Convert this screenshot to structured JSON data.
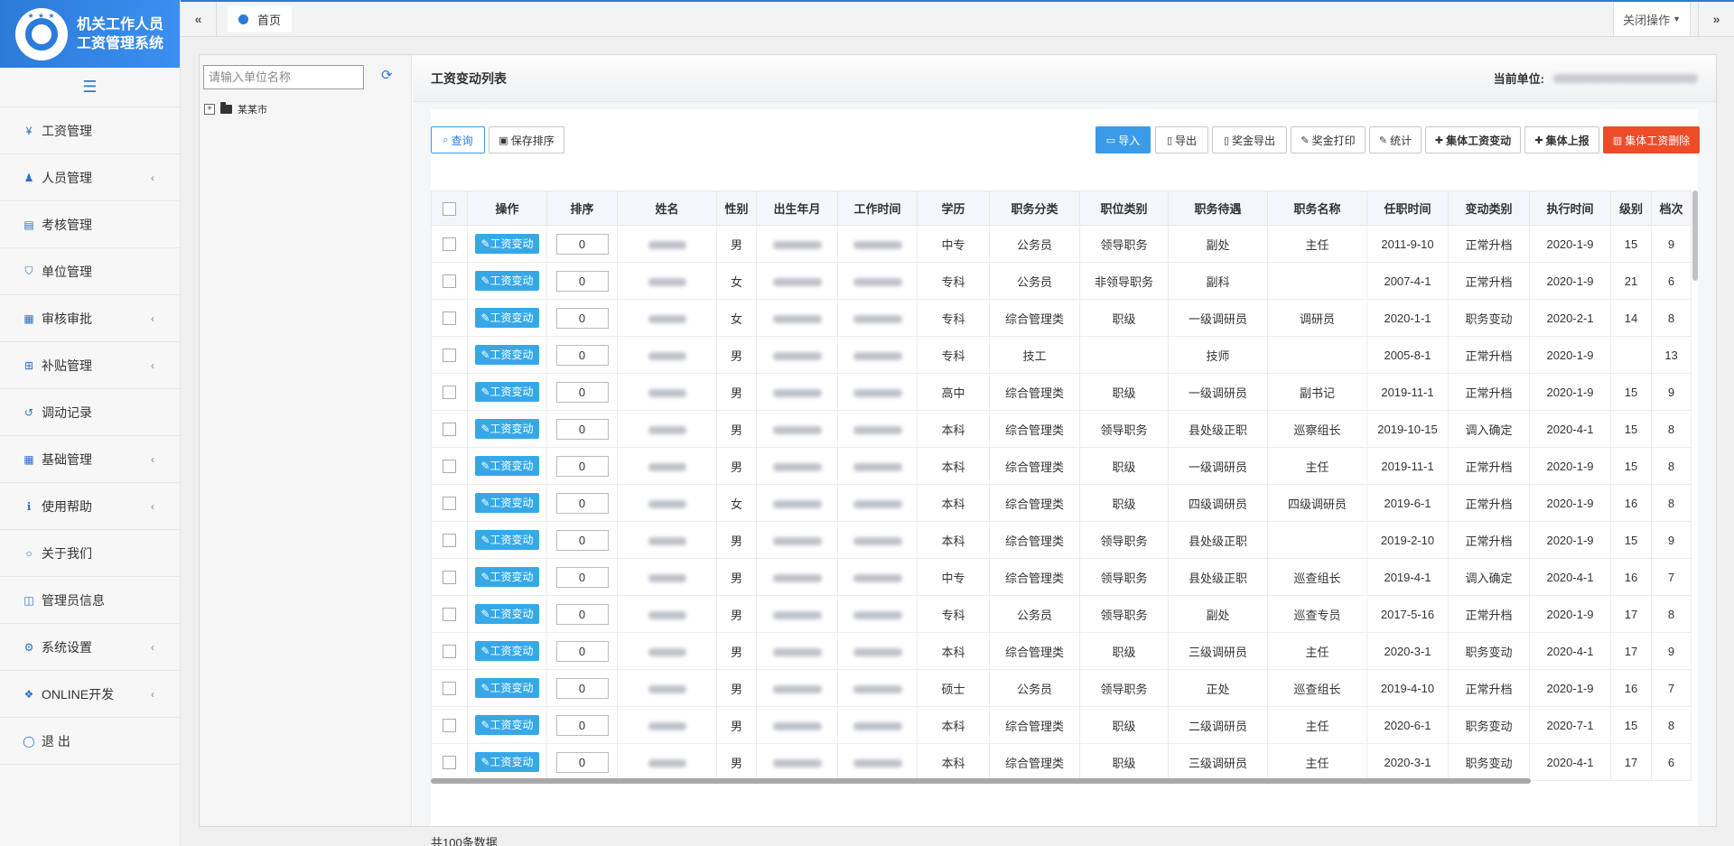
{
  "app": {
    "title_line1": "机关工作人员",
    "title_line2": "工资管理系统",
    "brand_color": "#2b7bd8"
  },
  "sidebar": {
    "items": [
      {
        "label": "工资管理",
        "icon": "yen-icon",
        "expandable": false
      },
      {
        "label": "人员管理",
        "icon": "user-add-icon",
        "expandable": true
      },
      {
        "label": "考核管理",
        "icon": "book-icon",
        "expandable": false
      },
      {
        "label": "单位管理",
        "icon": "shield-icon",
        "expandable": false
      },
      {
        "label": "审核审批",
        "icon": "calendar-check-icon",
        "expandable": true
      },
      {
        "label": "补贴管理",
        "icon": "plus-square-icon",
        "expandable": true
      },
      {
        "label": "调动记录",
        "icon": "history-icon",
        "expandable": false
      },
      {
        "label": "基础管理",
        "icon": "table-icon",
        "expandable": true
      },
      {
        "label": "使用帮助",
        "icon": "info-icon",
        "expandable": true
      },
      {
        "label": "关于我们",
        "icon": "circle-icon",
        "expandable": false
      },
      {
        "label": "管理员信息",
        "icon": "columns-icon",
        "expandable": false
      },
      {
        "label": "系统设置",
        "icon": "gear-icon",
        "expandable": true
      },
      {
        "label": "ONLINE开发",
        "icon": "cubes-icon",
        "expandable": true
      },
      {
        "label": "退  出",
        "icon": "power-icon",
        "expandable": false
      }
    ]
  },
  "topbar": {
    "home_tab": "首页",
    "close_ops": "关闭操作"
  },
  "tree": {
    "search_placeholder": "请输入单位名称",
    "root_node": "某某市"
  },
  "panel": {
    "title": "工资变动列表",
    "current_unit_label": "当前单位:"
  },
  "toolbar": {
    "query": "查询",
    "save_sort": "保存排序",
    "import": "导入",
    "export": "导出",
    "bonus_export": "奖金导出",
    "bonus_print": "奖金打印",
    "stats": "统计",
    "group_change": "集体工资变动",
    "group_report": "集体上报",
    "group_delete": "集体工资删除"
  },
  "table": {
    "headers": [
      "",
      "操作",
      "排序",
      "姓名",
      "性别",
      "出生年月",
      "工作时间",
      "学历",
      "职务分类",
      "职位类别",
      "职务待遇",
      "职务名称",
      "任职时间",
      "变动类别",
      "执行时间",
      "级别",
      "档次"
    ],
    "action_label": "工资变动",
    "rows": [
      {
        "sort": "0",
        "gender": "男",
        "edu": "中专",
        "cat": "公务员",
        "pos_type": "领导职务",
        "treat": "副处",
        "title": "主任",
        "start": "2011-9-10",
        "change": "正常升档",
        "exec": "2020-1-9",
        "level": "15",
        "grade": "9"
      },
      {
        "sort": "0",
        "gender": "女",
        "edu": "专科",
        "cat": "公务员",
        "pos_type": "非领导职务",
        "treat": "副科",
        "title": "",
        "start": "2007-4-1",
        "change": "正常升档",
        "exec": "2020-1-9",
        "level": "21",
        "grade": "6"
      },
      {
        "sort": "0",
        "gender": "女",
        "edu": "专科",
        "cat": "综合管理类",
        "pos_type": "职级",
        "treat": "一级调研员",
        "title": "调研员",
        "start": "2020-1-1",
        "change": "职务变动",
        "exec": "2020-2-1",
        "level": "14",
        "grade": "8"
      },
      {
        "sort": "0",
        "gender": "男",
        "edu": "专科",
        "cat": "技工",
        "pos_type": "",
        "treat": "技师",
        "title": "",
        "start": "2005-8-1",
        "change": "正常升档",
        "exec": "2020-1-9",
        "level": "",
        "grade": "13"
      },
      {
        "sort": "0",
        "gender": "男",
        "edu": "高中",
        "cat": "综合管理类",
        "pos_type": "职级",
        "treat": "一级调研员",
        "title": "副书记",
        "start": "2019-11-1",
        "change": "正常升档",
        "exec": "2020-1-9",
        "level": "15",
        "grade": "9"
      },
      {
        "sort": "0",
        "gender": "男",
        "edu": "本科",
        "cat": "综合管理类",
        "pos_type": "领导职务",
        "treat": "县处级正职",
        "title": "巡察组长",
        "start": "2019-10-15",
        "change": "调入确定",
        "exec": "2020-4-1",
        "level": "15",
        "grade": "8"
      },
      {
        "sort": "0",
        "gender": "男",
        "edu": "本科",
        "cat": "综合管理类",
        "pos_type": "职级",
        "treat": "一级调研员",
        "title": "主任",
        "start": "2019-11-1",
        "change": "正常升档",
        "exec": "2020-1-9",
        "level": "15",
        "grade": "8"
      },
      {
        "sort": "0",
        "gender": "女",
        "edu": "本科",
        "cat": "综合管理类",
        "pos_type": "职级",
        "treat": "四级调研员",
        "title": "四级调研员",
        "start": "2019-6-1",
        "change": "正常升档",
        "exec": "2020-1-9",
        "level": "16",
        "grade": "8"
      },
      {
        "sort": "0",
        "gender": "男",
        "edu": "本科",
        "cat": "综合管理类",
        "pos_type": "领导职务",
        "treat": "县处级正职",
        "title": "",
        "start": "2019-2-10",
        "change": "正常升档",
        "exec": "2020-1-9",
        "level": "15",
        "grade": "9"
      },
      {
        "sort": "0",
        "gender": "男",
        "edu": "中专",
        "cat": "综合管理类",
        "pos_type": "领导职务",
        "treat": "县处级正职",
        "title": "巡查组长",
        "start": "2019-4-1",
        "change": "调入确定",
        "exec": "2020-4-1",
        "level": "16",
        "grade": "7"
      },
      {
        "sort": "0",
        "gender": "男",
        "edu": "专科",
        "cat": "公务员",
        "pos_type": "领导职务",
        "treat": "副处",
        "title": "巡查专员",
        "start": "2017-5-16",
        "change": "正常升档",
        "exec": "2020-1-9",
        "level": "17",
        "grade": "8"
      },
      {
        "sort": "0",
        "gender": "男",
        "edu": "本科",
        "cat": "综合管理类",
        "pos_type": "职级",
        "treat": "三级调研员",
        "title": "主任",
        "start": "2020-3-1",
        "change": "职务变动",
        "exec": "2020-4-1",
        "level": "17",
        "grade": "9"
      },
      {
        "sort": "0",
        "gender": "男",
        "edu": "硕士",
        "cat": "公务员",
        "pos_type": "领导职务",
        "treat": "正处",
        "title": "巡查组长",
        "start": "2019-4-10",
        "change": "正常升档",
        "exec": "2020-1-9",
        "level": "16",
        "grade": "7"
      },
      {
        "sort": "0",
        "gender": "男",
        "edu": "本科",
        "cat": "综合管理类",
        "pos_type": "职级",
        "treat": "二级调研员",
        "title": "主任",
        "start": "2020-6-1",
        "change": "职务变动",
        "exec": "2020-7-1",
        "level": "15",
        "grade": "8"
      },
      {
        "sort": "0",
        "gender": "男",
        "edu": "本科",
        "cat": "综合管理类",
        "pos_type": "职级",
        "treat": "三级调研员",
        "title": "主任",
        "start": "2020-3-1",
        "change": "职务变动",
        "exec": "2020-4-1",
        "level": "17",
        "grade": "6"
      }
    ],
    "total": "共100条数据"
  },
  "colors": {
    "primary": "#3a9ce8",
    "danger": "#ee4b28",
    "action_button": "#36a8e8"
  }
}
